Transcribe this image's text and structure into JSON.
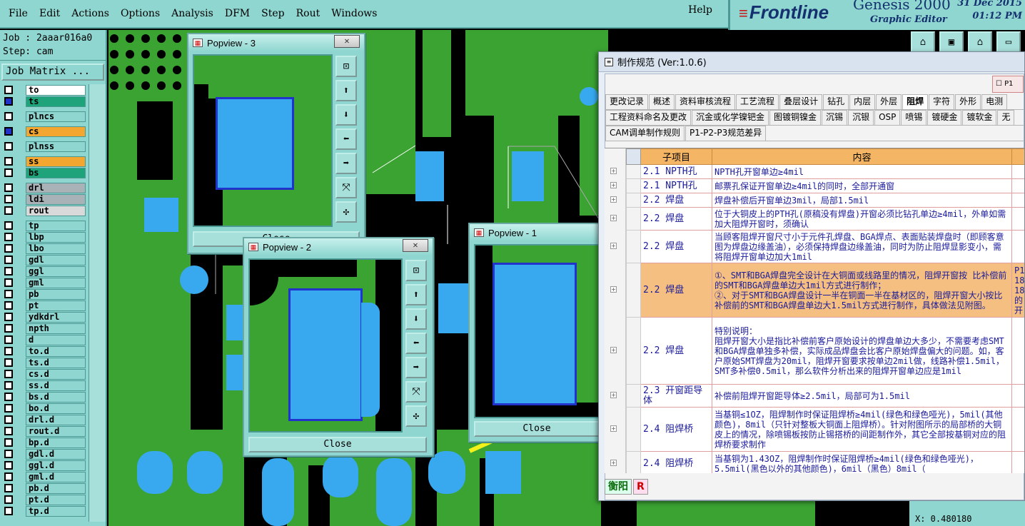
{
  "menu": [
    "File",
    "Edit",
    "Actions",
    "Options",
    "Analysis",
    "DFM",
    "Step",
    "Rout",
    "Windows"
  ],
  "help": "Help",
  "brand": {
    "logo": "Frontline",
    "product": "Genesis 2000",
    "subtitle": "Graphic Editor",
    "date": "31 Dec 2015",
    "time": "01:12 PM"
  },
  "job": {
    "job_line": "Job : 2aaar016a0",
    "step_line": "Step: cam",
    "matrix_button": "Job Matrix ..."
  },
  "layers": [
    {
      "name": "to",
      "on": false,
      "color": "#ffffff",
      "mark": "✎"
    },
    {
      "name": "ts",
      "on": true,
      "color": "#1fa37a",
      "mark": ""
    },
    {
      "name": "gap"
    },
    {
      "name": "plncs",
      "on": false,
      "color": "#8fd6d0",
      "mark": ""
    },
    {
      "name": "gap"
    },
    {
      "name": "cs",
      "on": true,
      "color": "#f3a630",
      "mark": "✎▪"
    },
    {
      "name": "gap"
    },
    {
      "name": "plnss",
      "on": false,
      "color": "#8fd6d0",
      "mark": ""
    },
    {
      "name": "gap"
    },
    {
      "name": "ss",
      "on": false,
      "color": "#f3a630",
      "mark": "✎"
    },
    {
      "name": "bs",
      "on": false,
      "color": "#1fa37a",
      "mark": ""
    },
    {
      "name": "gap"
    },
    {
      "name": "drl",
      "on": false,
      "color": "#a9b3b7",
      "mark": ""
    },
    {
      "name": "ldi",
      "on": false,
      "color": "#a9b3b7",
      "mark": ""
    },
    {
      "name": "rout",
      "on": false,
      "color": "#d9d9d9",
      "mark": ""
    },
    {
      "name": "gap"
    },
    {
      "name": "tp",
      "on": false,
      "color": "#8fd6d0",
      "mark": ""
    },
    {
      "name": "lbp",
      "on": false,
      "color": "#8fd6d0",
      "mark": ""
    },
    {
      "name": "lbo",
      "on": false,
      "color": "#8fd6d0",
      "mark": ""
    },
    {
      "name": "gdl",
      "on": false,
      "color": "#8fd6d0",
      "mark": "✎"
    },
    {
      "name": "ggl",
      "on": false,
      "color": "#8fd6d0",
      "mark": ""
    },
    {
      "name": "gml",
      "on": false,
      "color": "#8fd6d0",
      "mark": ""
    },
    {
      "name": "pb",
      "on": false,
      "color": "#8fd6d0",
      "mark": ""
    },
    {
      "name": "pt",
      "on": false,
      "color": "#8fd6d0",
      "mark": ""
    },
    {
      "name": "ydkdrl",
      "on": false,
      "color": "#8fd6d0",
      "mark": ""
    },
    {
      "name": "npth",
      "on": false,
      "color": "#8fd6d0",
      "mark": ""
    },
    {
      "name": "d",
      "on": false,
      "color": "#8fd6d0",
      "mark": ""
    },
    {
      "name": "to.d",
      "on": false,
      "color": "#8fd6d0",
      "mark": "✎"
    },
    {
      "name": "ts.d",
      "on": false,
      "color": "#8fd6d0",
      "mark": ""
    },
    {
      "name": "cs.d",
      "on": false,
      "color": "#8fd6d0",
      "mark": "✎"
    },
    {
      "name": "ss.d",
      "on": false,
      "color": "#8fd6d0",
      "mark": "✎"
    },
    {
      "name": "bs.d",
      "on": false,
      "color": "#8fd6d0",
      "mark": ""
    },
    {
      "name": "bo.d",
      "on": false,
      "color": "#8fd6d0",
      "mark": ""
    },
    {
      "name": "drl.d",
      "on": false,
      "color": "#8fd6d0",
      "mark": ""
    },
    {
      "name": "rout.d",
      "on": false,
      "color": "#8fd6d0",
      "mark": ""
    },
    {
      "name": "bp.d",
      "on": false,
      "color": "#8fd6d0",
      "mark": ""
    },
    {
      "name": "gdl.d",
      "on": false,
      "color": "#8fd6d0",
      "mark": "✎"
    },
    {
      "name": "ggl.d",
      "on": false,
      "color": "#8fd6d0",
      "mark": ""
    },
    {
      "name": "gml.d",
      "on": false,
      "color": "#8fd6d0",
      "mark": ""
    },
    {
      "name": "pb.d",
      "on": false,
      "color": "#8fd6d0",
      "mark": ""
    },
    {
      "name": "pt.d",
      "on": false,
      "color": "#8fd6d0",
      "mark": ""
    },
    {
      "name": "tp.d",
      "on": false,
      "color": "#8fd6d0",
      "mark": ""
    }
  ],
  "popviews": {
    "p3": {
      "title": "Popview - 3",
      "close": "Close"
    },
    "p2": {
      "title": "Popview - 2",
      "close": "Close"
    },
    "p1": {
      "title": "Popview - 1",
      "close": "Close"
    }
  },
  "spec": {
    "title": "制作规范 (Ver:1.0.6)",
    "corner_label": "P1",
    "tabs_row1": [
      "更改记录",
      "概述",
      "资料审核流程",
      "工艺流程",
      "叠层设计",
      "钻孔",
      "内层",
      "外层",
      "阻焊",
      "字符",
      "外形",
      "电测"
    ],
    "active_tab": "阻焊",
    "tabs_row2": [
      "工程资料命名及更改",
      "沉金或化学镍钯金",
      "图镀铜镍金",
      "沉锡",
      "沉银",
      "OSP",
      "喷锡",
      "镀硬金",
      "镀软金",
      "无"
    ],
    "tabs_row3": [
      "CAM调单制作规则",
      "P1-P2-P3规范差异"
    ],
    "col_item": "子项目",
    "col_content": "内容",
    "rows": [
      {
        "item": "2.1 NPTH孔",
        "content": "NPTH孔开窗单边≥4mil",
        "extra": "",
        "h": 20
      },
      {
        "item": "2.1 NPTH孔",
        "content": "邮票孔保证开窗单边≥4mil的同时，全部开通窗",
        "extra": "",
        "h": 20
      },
      {
        "item": "2.2 焊盘",
        "content": "焊盘补偿后开窗单边3mil，局部1.5mil",
        "extra": "",
        "h": 20
      },
      {
        "item": "2.2 焊盘",
        "content": "位于大铜皮上的PTH孔(原稿没有焊盘)开窗必须比钻孔单边≥4mil，外单如需加大阻焊开窗时，须确认",
        "extra": "",
        "h": 32
      },
      {
        "item": "2.2 焊盘",
        "content": "当顾客阻焊开窗尺寸小于元件孔焊盘、BGA焊点、表面贴装焊盘时（即顾客意图为焊盘边缘盖油），必须保持焊盘边缘盖油，同时为防止阻焊显影变小，需将阻焊开窗单边加大1mil",
        "extra": "",
        "h": 46
      },
      {
        "item": "2.2 焊盘",
        "content": "①、SMT和BGA焊盘完全设计在大铜面或线路里的情况，阻焊开窗按 比补偿前的SMT和BGA焊盘单边大1mil方式进行制作；\n②、对于SMT和BGA焊盘设计一半在铜面一半在基材区的，阻焊开窗大小按比补偿前的SMT和BGA焊盘单边大1.5mil方式进行制作，具体做法见附图。",
        "extra": "P1 18 18 的 开",
        "h": 76,
        "hl": true
      },
      {
        "item": "2.2 焊盘",
        "content": "特别说明：\n阻焊开窗大小是指比补偿前客户原始设计的焊盘单边大多少，不需要考虑SMT和BGA焊盘单独多补偿，实际成品焊盘会比客户原始焊盘偏大的问题。如，客户原始SMT焊盘为20mil，阻焊开窗要求按单边2mil做，线路补偿1.5mil，SMT多补偿0.5mil，那么软件分析出来的阻焊开窗单边应是1mil",
        "extra": "",
        "h": 94
      },
      {
        "item": "2.3 开窗距导体",
        "content": "补偿前阻焊开窗距导体≥2.5mil，局部可为1.5mil",
        "extra": "",
        "h": 32
      },
      {
        "item": "2.4 阻焊桥",
        "content": "当基铜≤1OZ，阻焊制作时保证阻焊桥≥4mil(绿色和绿色哑光)，5mil(其他颜色)，8mil（只针对整板大铜面上阻焊桥）。针对附图所示的局部桥的大铜皮上的情况，除喷锡板按防止锡搭桥的间距制作外，其它全部按基铜对应的阻焊桥要求制作",
        "extra": "",
        "h": 62
      },
      {
        "item": "2.4 阻焊桥",
        "content": "当基铜为1.43OZ，阻焊制作时保证阻焊桥≥4mil(绿色和绿色哑光)，5.5mil(黑色以外的其他颜色)，6mil（黑色）8mil（",
        "extra": "",
        "h": 34
      }
    ],
    "bottom_tabs": [
      "衡阳",
      "R"
    ]
  },
  "status": "X: 0.480180",
  "colors": {
    "panel": "#8fd6d0",
    "green": "#3aa332",
    "blue": "#39a9ef",
    "arrow": "#f2f21a"
  }
}
